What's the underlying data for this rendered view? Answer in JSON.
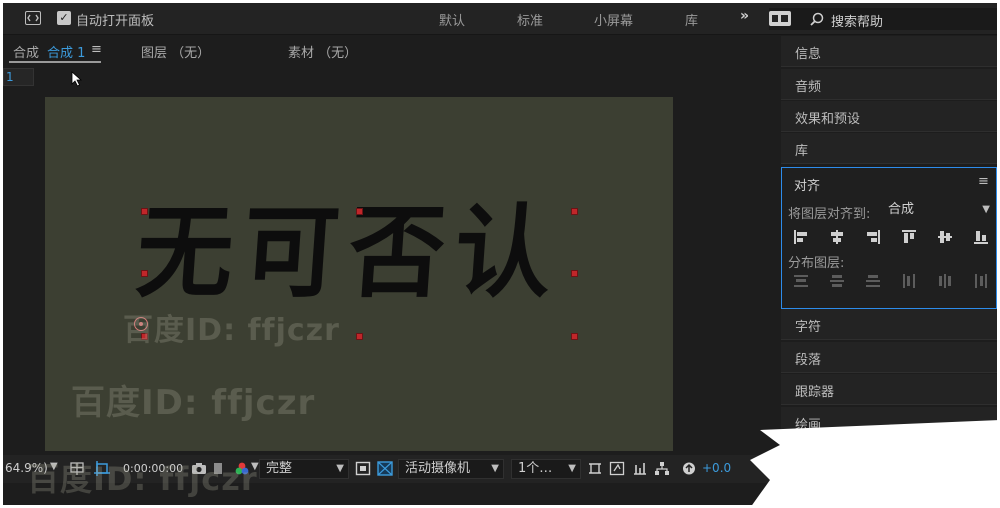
{
  "topbar": {
    "auto_open_label": "自动打开面板",
    "workspaces": [
      "默认",
      "标准",
      "小屏幕",
      "库"
    ],
    "more": "»",
    "search_label": "搜索帮助"
  },
  "comp_panel": {
    "tab_prefix": "合成",
    "tab_active": "合成 1",
    "tab_menu": "≡",
    "layer_tab": "图层 （无）",
    "footage_tab": "素材 （无）",
    "sub_field": "1",
    "comp_text": "无可否认",
    "toolbar": {
      "zoom": "64.9%)",
      "timecode": "0:00:00:00",
      "resolution": "完整",
      "camera": "活动摄像机",
      "views": "1个…",
      "exposure": "+0.0"
    }
  },
  "watermark_text": "百度ID: ffjczr",
  "right_panels": {
    "items": [
      "信息",
      "音频",
      "效果和预设",
      "库"
    ],
    "align": {
      "title": "对齐",
      "menu": "≡",
      "align_to_label": "将图层对齐到:",
      "align_to_value": "合成",
      "distribute_label": "分布图层:"
    },
    "lower_items": [
      "字符",
      "段落",
      "跟踪器",
      "绘画"
    ]
  },
  "colors": {
    "accent": "#3c9bdc",
    "panel_focus": "#2d8ceb",
    "viewer_bg": "#3c3f32",
    "handle": "#c0262a"
  }
}
